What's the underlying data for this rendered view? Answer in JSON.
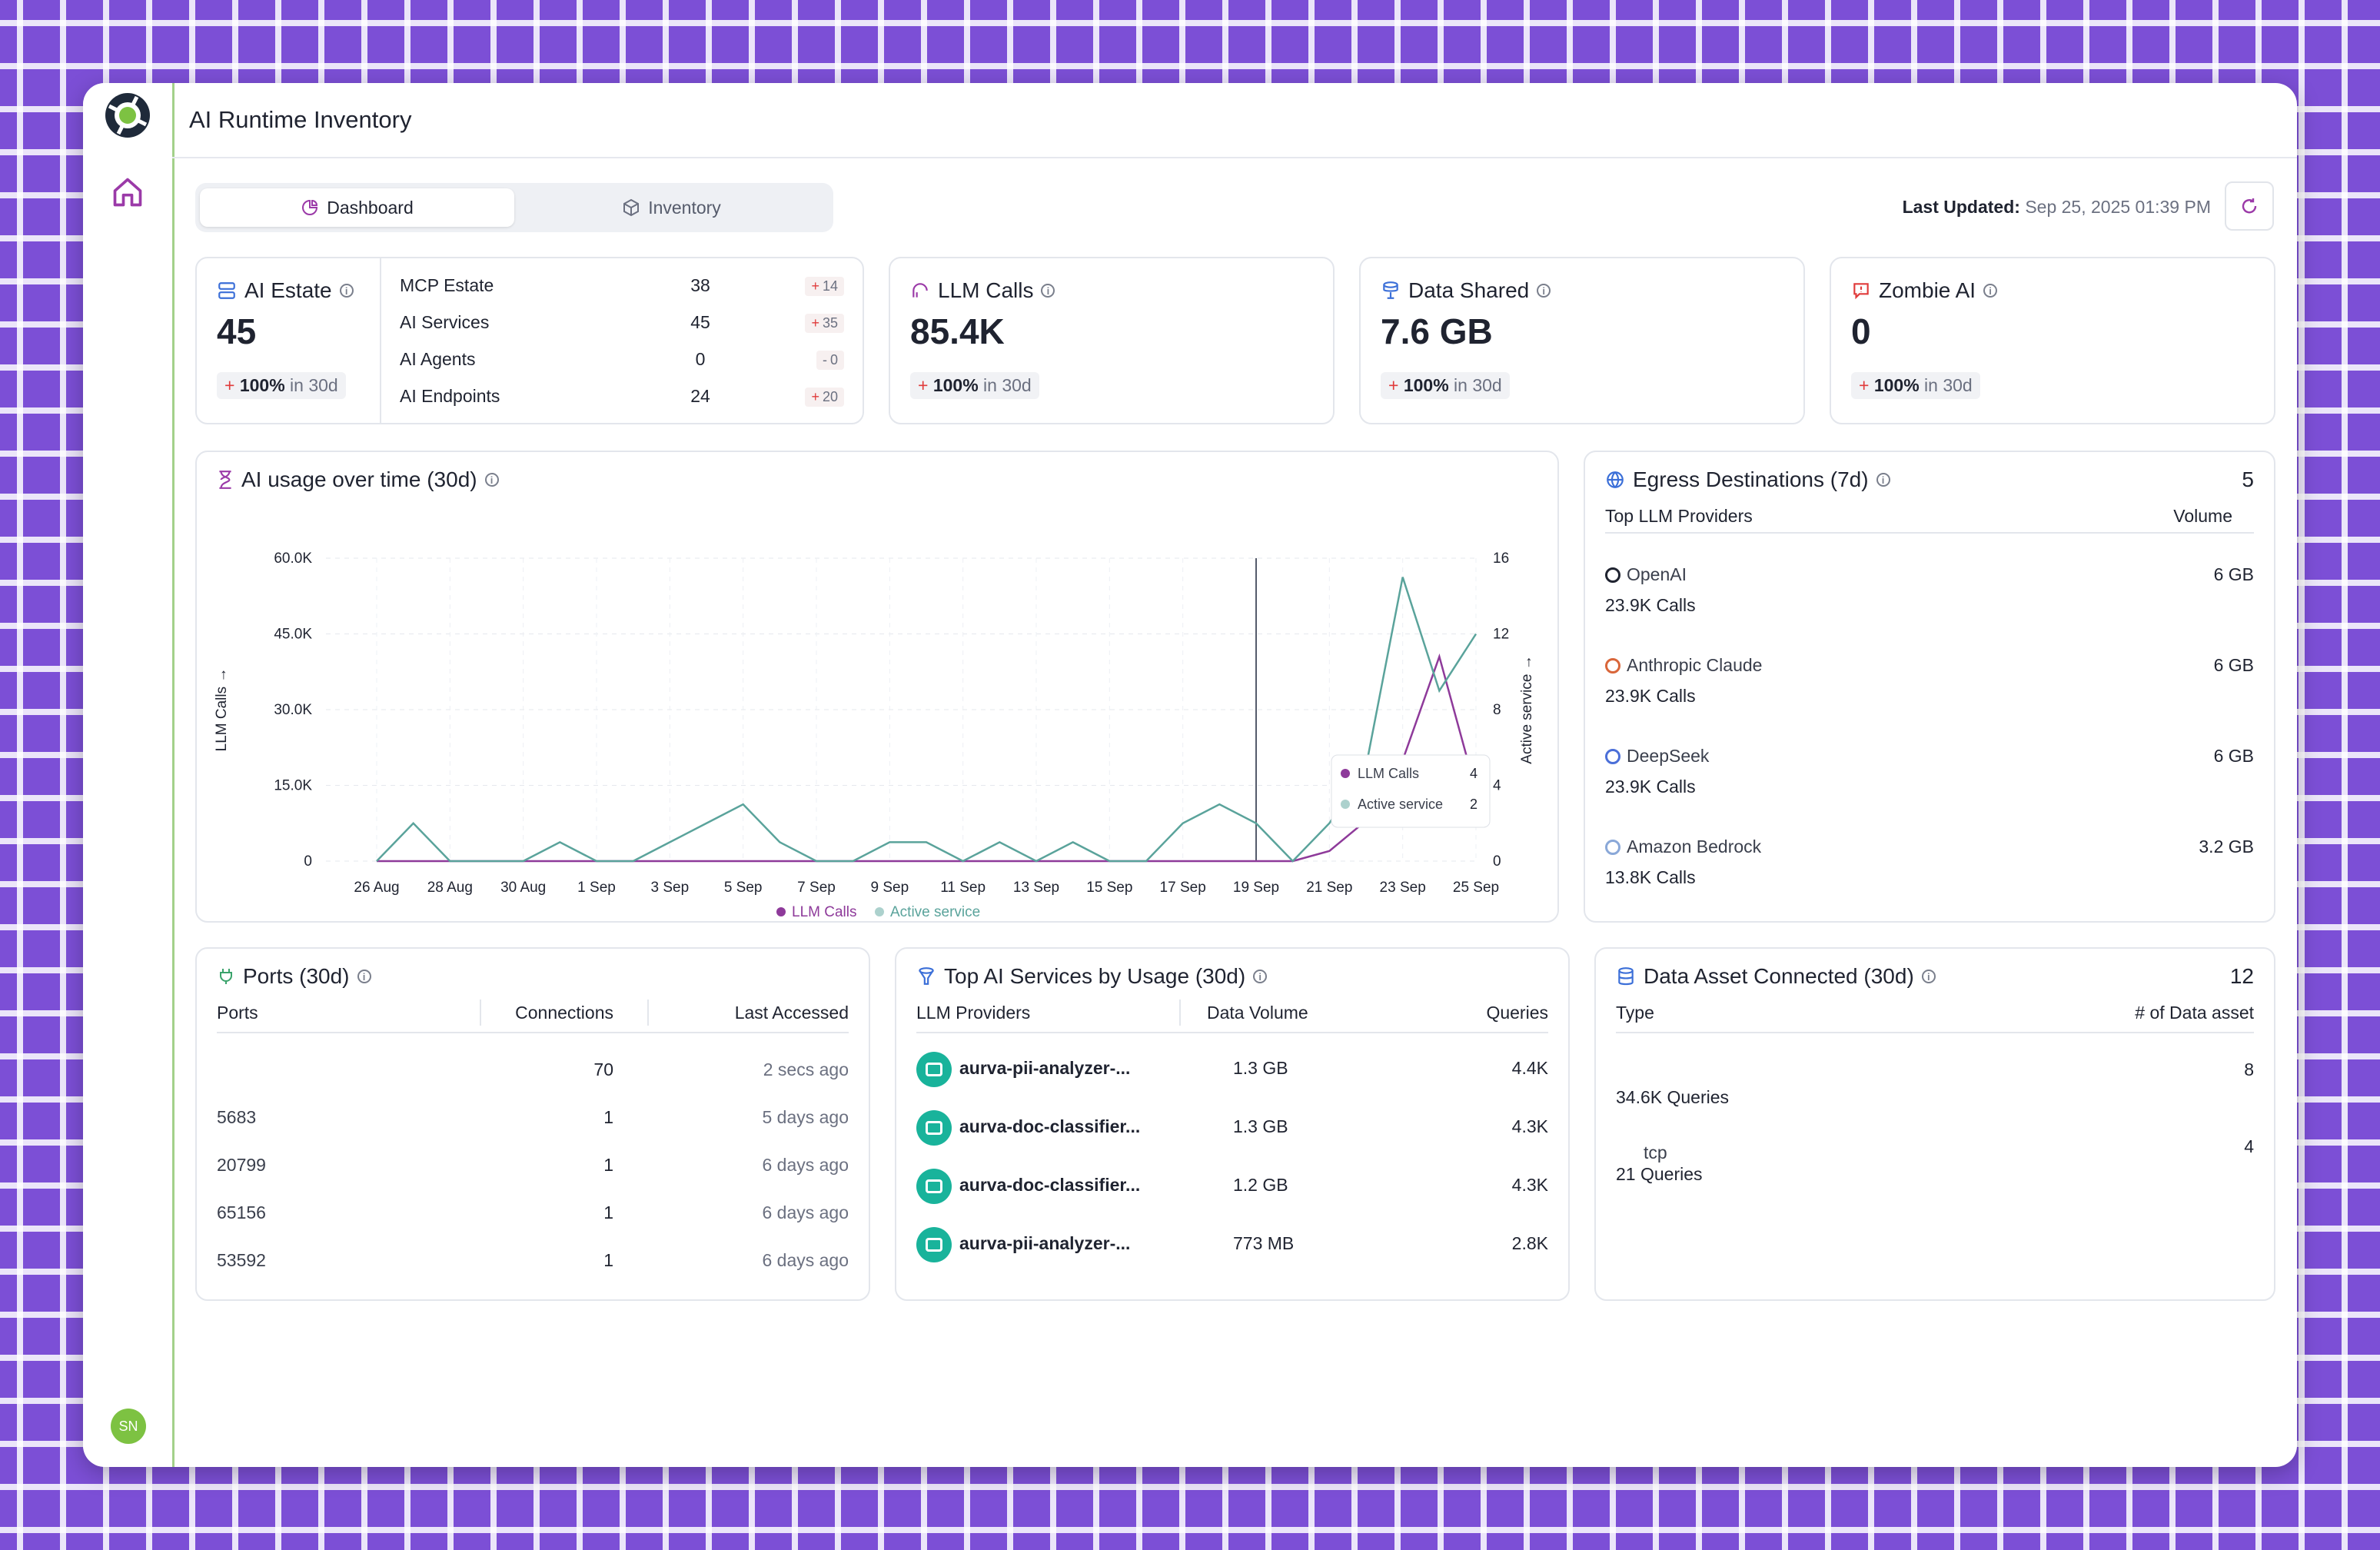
{
  "header": {
    "title": "AI Runtime Inventory"
  },
  "tabs": [
    {
      "label": "Dashboard"
    },
    {
      "label": "Inventory"
    }
  ],
  "updated": {
    "label": "Last Updated:",
    "value": "Sep 25, 2025 01:39 PM"
  },
  "kpis": {
    "estate": {
      "title": "AI Estate",
      "value": "45",
      "change": "100%",
      "period": "in 30d",
      "rows": [
        {
          "label": "MCP Estate",
          "value": "38",
          "delta": "14",
          "sign": "+"
        },
        {
          "label": "AI Services",
          "value": "45",
          "delta": "35",
          "sign": "+"
        },
        {
          "label": "AI Agents",
          "value": "0",
          "delta": "0",
          "sign": "-"
        },
        {
          "label": "AI Endpoints",
          "value": "24",
          "delta": "20",
          "sign": "+"
        }
      ]
    },
    "llm": {
      "title": "LLM Calls",
      "value": "85.4K",
      "change": "100%",
      "period": "in 30d"
    },
    "data": {
      "title": "Data Shared",
      "value": "7.6 GB",
      "change": "100%",
      "period": "in 30d"
    },
    "zombie": {
      "title": "Zombie AI",
      "value": "0",
      "change": "100%",
      "period": "in 30d"
    }
  },
  "usage": {
    "title": "AI usage over time (30d)",
    "chart_data": {
      "type": "line",
      "x": [
        "26 Aug",
        "27 Aug",
        "28 Aug",
        "29 Aug",
        "30 Aug",
        "31 Aug",
        "1 Sep",
        "2 Sep",
        "3 Sep",
        "4 Sep",
        "5 Sep",
        "6 Sep",
        "7 Sep",
        "8 Sep",
        "9 Sep",
        "10 Sep",
        "11 Sep",
        "12 Sep",
        "13 Sep",
        "14 Sep",
        "15 Sep",
        "16 Sep",
        "17 Sep",
        "18 Sep",
        "19 Sep",
        "20 Sep",
        "21 Sep",
        "22 Sep",
        "23 Sep",
        "24 Sep",
        "25 Sep"
      ],
      "tick_labels": [
        "26 Aug",
        "28 Aug",
        "30 Aug",
        "1 Sep",
        "3 Sep",
        "5 Sep",
        "7 Sep",
        "9 Sep",
        "11 Sep",
        "13 Sep",
        "15 Sep",
        "17 Sep",
        "19 Sep",
        "21 Sep",
        "23 Sep",
        "25 Sep"
      ],
      "series": [
        {
          "name": "LLM Calls",
          "axis": "left",
          "color": "#8e3a9a",
          "values": [
            0,
            0,
            0,
            0,
            0,
            0,
            0,
            0,
            0,
            0,
            0,
            0,
            0,
            0,
            0,
            0,
            0,
            0,
            0,
            0,
            0,
            0,
            0,
            0,
            0,
            0,
            2000,
            8000,
            20000,
            40500,
            14000
          ]
        },
        {
          "name": "Active service",
          "axis": "right",
          "color": "#5aa39b",
          "values": [
            0,
            2,
            0,
            0,
            0,
            1,
            0,
            0,
            1,
            2,
            3,
            1,
            0,
            0,
            1,
            1,
            0,
            1,
            0,
            1,
            0,
            0,
            2,
            3,
            2,
            0,
            2,
            5,
            15,
            9,
            12
          ]
        }
      ],
      "ylabel": "LLM Calls →",
      "y2label": "Active service →",
      "ylim": [
        0,
        60000
      ],
      "y2lim": [
        0,
        16
      ],
      "yticks": [
        "0",
        "15.0K",
        "30.0K",
        "45.0K",
        "60.0K"
      ],
      "y2ticks": [
        "0",
        "4",
        "8",
        "12",
        "16"
      ],
      "grid": true,
      "legend": "bottom",
      "tooltip": {
        "rows": [
          {
            "name": "LLM Calls",
            "value": "4"
          },
          {
            "name": "Active service",
            "value": "2"
          }
        ]
      }
    }
  },
  "egress": {
    "title": "Egress Destinations (7d)",
    "count": "5",
    "col1": "Top LLM Providers",
    "col2": "Volume",
    "items": [
      {
        "name": "OpenAI",
        "calls": "23.9K Calls",
        "volume": "6 GB"
      },
      {
        "name": "Anthropic Claude",
        "calls": "23.9K Calls",
        "volume": "6 GB"
      },
      {
        "name": "DeepSeek",
        "calls": "23.9K Calls",
        "volume": "6 GB"
      },
      {
        "name": "Amazon Bedrock",
        "calls": "13.8K Calls",
        "volume": "3.2 GB"
      }
    ]
  },
  "ports": {
    "title": "Ports (30d)",
    "cols": [
      "Ports",
      "Connections",
      "Last Accessed"
    ],
    "rows": [
      {
        "port": "",
        "conn": "70",
        "last": "2 secs ago"
      },
      {
        "port": "5683",
        "conn": "1",
        "last": "5 days ago"
      },
      {
        "port": "20799",
        "conn": "1",
        "last": "6 days ago"
      },
      {
        "port": "65156",
        "conn": "1",
        "last": "6 days ago"
      },
      {
        "port": "53592",
        "conn": "1",
        "last": "6 days ago"
      }
    ]
  },
  "services": {
    "title": "Top AI Services by Usage (30d)",
    "cols": [
      "LLM Providers",
      "Data Volume",
      "Queries"
    ],
    "rows": [
      {
        "name": "aurva-pii-analyzer-...",
        "volume": "1.3 GB",
        "queries": "4.4K"
      },
      {
        "name": "aurva-doc-classifier...",
        "volume": "1.3 GB",
        "queries": "4.3K"
      },
      {
        "name": "aurva-doc-classifier...",
        "volume": "1.2 GB",
        "queries": "4.3K"
      },
      {
        "name": "aurva-pii-analyzer-...",
        "volume": "773 MB",
        "queries": "2.8K"
      }
    ]
  },
  "assets": {
    "title": "Data Asset Connected (30d)",
    "count": "12",
    "cols": [
      "Type",
      "# of Data asset"
    ],
    "rows": [
      {
        "type": "",
        "queries": "34.6K Queries",
        "count": "8"
      },
      {
        "type": "tcp",
        "queries": "21 Queries",
        "count": "4"
      }
    ]
  },
  "user": {
    "initials": "SN"
  }
}
